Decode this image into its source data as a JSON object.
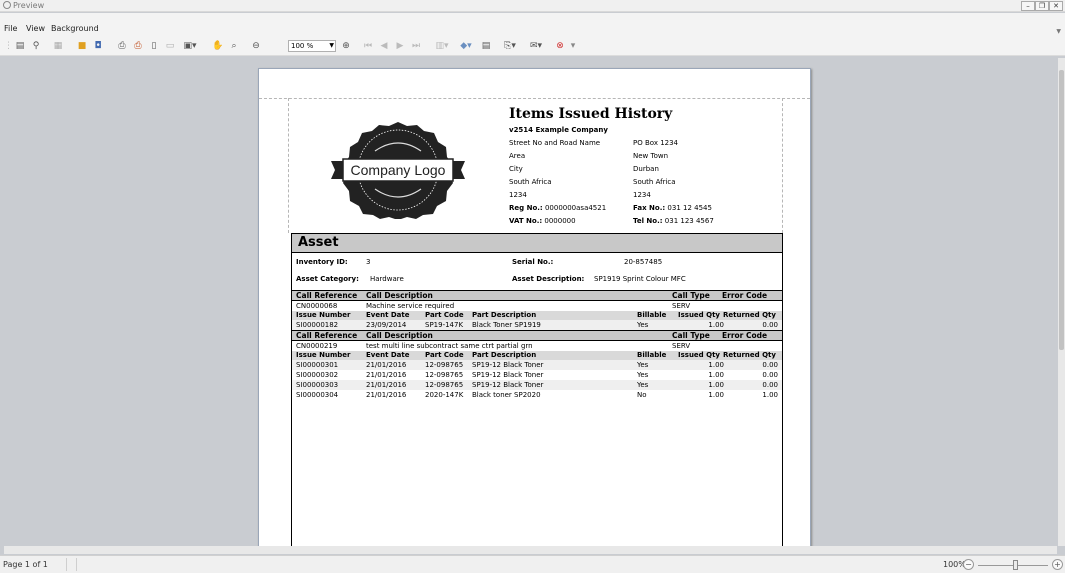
{
  "window": {
    "title": "Preview"
  },
  "menu": {
    "file": "File",
    "view": "View",
    "background": "Background"
  },
  "toolbar": {
    "zoom_value": "100 %"
  },
  "icons": {
    "toc": "toc-icon",
    "search": "binoculars-icon",
    "thumbs": "thumbnails-icon",
    "open": "folder-open-icon",
    "save": "save-icon",
    "print": "printer-icon",
    "quick_print": "quick-print-icon",
    "page_setup": "page-setup-icon",
    "scale": "scale-icon",
    "hand": "hand-tool-icon",
    "magnifier": "magnifier-icon",
    "zoom_out": "zoom-out-icon",
    "zoom_in": "zoom-in-icon",
    "first": "first-page-icon",
    "prev": "previous-page-icon",
    "next": "next-page-icon",
    "last": "last-page-icon",
    "multipage": "multiple-pages-icon",
    "color": "page-color-icon",
    "watermark": "watermark-icon",
    "export": "export-icon",
    "email": "email-icon",
    "close": "close-preview-icon"
  },
  "report": {
    "title": "Items Issued History",
    "logo_text": "Company Logo",
    "company": "v2514 Example Company",
    "address_left": [
      "Street No and Road Name",
      "Area",
      "City",
      "South Africa",
      "1234"
    ],
    "address_right": [
      "PO Box 1234",
      "New Town",
      "Durban",
      "South Africa",
      "1234"
    ],
    "reg_label": "Reg No.:",
    "reg_value": "0000000asa4521",
    "fax_label": "Fax No.:",
    "fax_value": "031 12 4545",
    "vat_label": "VAT No.:",
    "vat_value": "0000000",
    "tel_label": "Tel No.:",
    "tel_value": "031 123 4567",
    "section_title": "Asset",
    "inventory_label": "Inventory ID:",
    "inventory_value": "3",
    "serial_label": "Serial No.:",
    "serial_value": "20-857485",
    "category_label": "Asset Category:",
    "category_value": "Hardware",
    "description_label": "Asset Description:",
    "description_value": "SP1919 Sprint Colour MFC",
    "call_headers": {
      "ref": "Call Reference",
      "desc": "Call Description",
      "type": "Call Type",
      "error": "Error Code"
    },
    "issue_headers": {
      "number": "Issue Number",
      "date": "Event Date",
      "code": "Part Code",
      "desc": "Part Description",
      "billable": "Billable",
      "issued": "Issued Qty",
      "returned": "Returned Qty"
    },
    "calls": [
      {
        "ref": "CN0000068",
        "desc": "Machine service required",
        "type": "SERV",
        "error": "",
        "issues": [
          {
            "number": "SI00000182",
            "date": "23/09/2014",
            "code": "SP19-147K",
            "desc": "Black Toner SP1919",
            "billable": "Yes",
            "issued": "1.00",
            "returned": "0.00"
          }
        ]
      },
      {
        "ref": "CN0000219",
        "desc": "test multi line subcontract same ctrt partial grn",
        "type": "SERV",
        "error": "",
        "issues": [
          {
            "number": "SI00000301",
            "date": "21/01/2016",
            "code": "12-098765",
            "desc": "SP19-12 Black Toner",
            "billable": "Yes",
            "issued": "1.00",
            "returned": "0.00"
          },
          {
            "number": "SI00000302",
            "date": "21/01/2016",
            "code": "12-098765",
            "desc": "SP19-12 Black Toner",
            "billable": "Yes",
            "issued": "1.00",
            "returned": "0.00"
          },
          {
            "number": "SI00000303",
            "date": "21/01/2016",
            "code": "12-098765",
            "desc": "SP19-12 Black Toner",
            "billable": "Yes",
            "issued": "1.00",
            "returned": "0.00"
          },
          {
            "number": "SI00000304",
            "date": "21/01/2016",
            "code": "2020-147K",
            "desc": "Black toner SP2020",
            "billable": "No",
            "issued": "1.00",
            "returned": "1.00"
          }
        ]
      }
    ]
  },
  "status": {
    "page": "Page 1 of 1",
    "zoom": "100%"
  }
}
